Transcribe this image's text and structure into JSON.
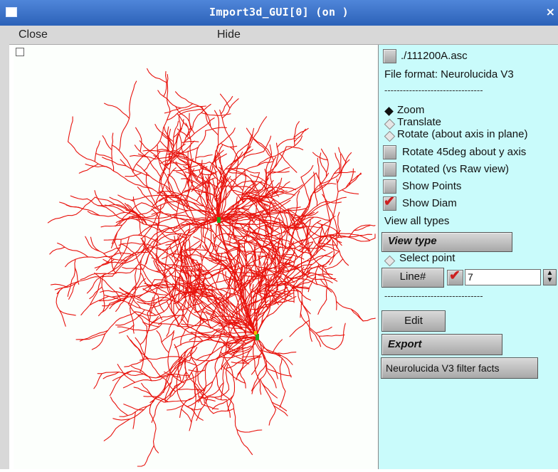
{
  "window": {
    "title": "Import3d_GUI[0] (on )",
    "close_glyph": "×"
  },
  "menu": {
    "close_label": "Close",
    "hide_label": "Hide"
  },
  "panel": {
    "file_button_label": "./111200A.asc",
    "file_format": "File format: Neurolucida V3",
    "separator": "--------------------------------",
    "radio_zoom": "Zoom",
    "radio_translate": "Translate",
    "radio_rotate": "Rotate (about axis in plane)",
    "rotate45_label": "Rotate 45deg about y axis",
    "rotated_label": "Rotated (vs Raw view)",
    "show_points_label": "Show Points",
    "show_diam_label": "Show Diam",
    "view_all_types": "View all types",
    "view_type_button": "View type",
    "select_point": "Select point",
    "line_button": "Line#",
    "line_value": "7",
    "separator2": "--------------------------------",
    "edit_button": "Edit",
    "export_button": "Export",
    "filter_button": "Neurolucida V3 filter facts"
  },
  "colors": {
    "dendrite": "#e8120c",
    "soma": "#22aa22",
    "panel_bg": "#c9fbfb",
    "titlebar": "#3b73c7"
  },
  "icons": [
    "window-menu-icon",
    "close-icon",
    "checkmark-icon",
    "spinner-arrows-icon"
  ]
}
